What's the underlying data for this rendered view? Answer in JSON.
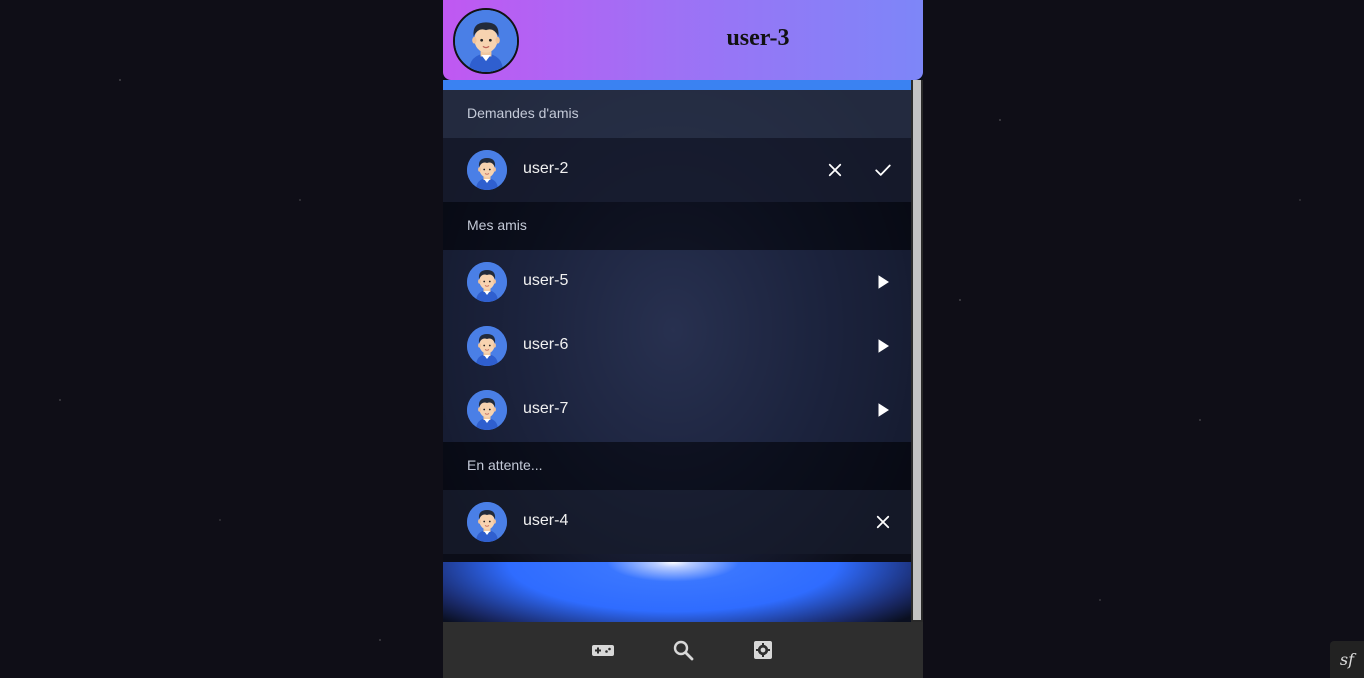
{
  "header": {
    "title": "user-3",
    "avatar_icon": "user-avatar-icon"
  },
  "sections": {
    "requests": {
      "title": "Demandes d'amis",
      "items": [
        {
          "name": "user-2",
          "actions": [
            "close-icon",
            "check-icon"
          ]
        }
      ]
    },
    "friends": {
      "title": "Mes amis",
      "items": [
        {
          "name": "user-5",
          "actions": [
            "play-icon"
          ]
        },
        {
          "name": "user-6",
          "actions": [
            "play-icon"
          ]
        },
        {
          "name": "user-7",
          "actions": [
            "play-icon"
          ]
        }
      ]
    },
    "pending": {
      "title": "En attente...",
      "items": [
        {
          "name": "user-4",
          "actions": [
            "close-icon"
          ]
        }
      ]
    }
  },
  "footer": {
    "icons": [
      "gamepad-icon",
      "search-icon",
      "settings-icon"
    ]
  },
  "badge": {
    "icon": "symfony-icon",
    "text": "sf"
  },
  "colors": {
    "header_gradient_start": "#c058f2",
    "header_gradient_end": "#7d86f8",
    "accent": "#3a82f2",
    "footer_bg": "#2e2e2e",
    "page_bg": "#0f0e17"
  }
}
